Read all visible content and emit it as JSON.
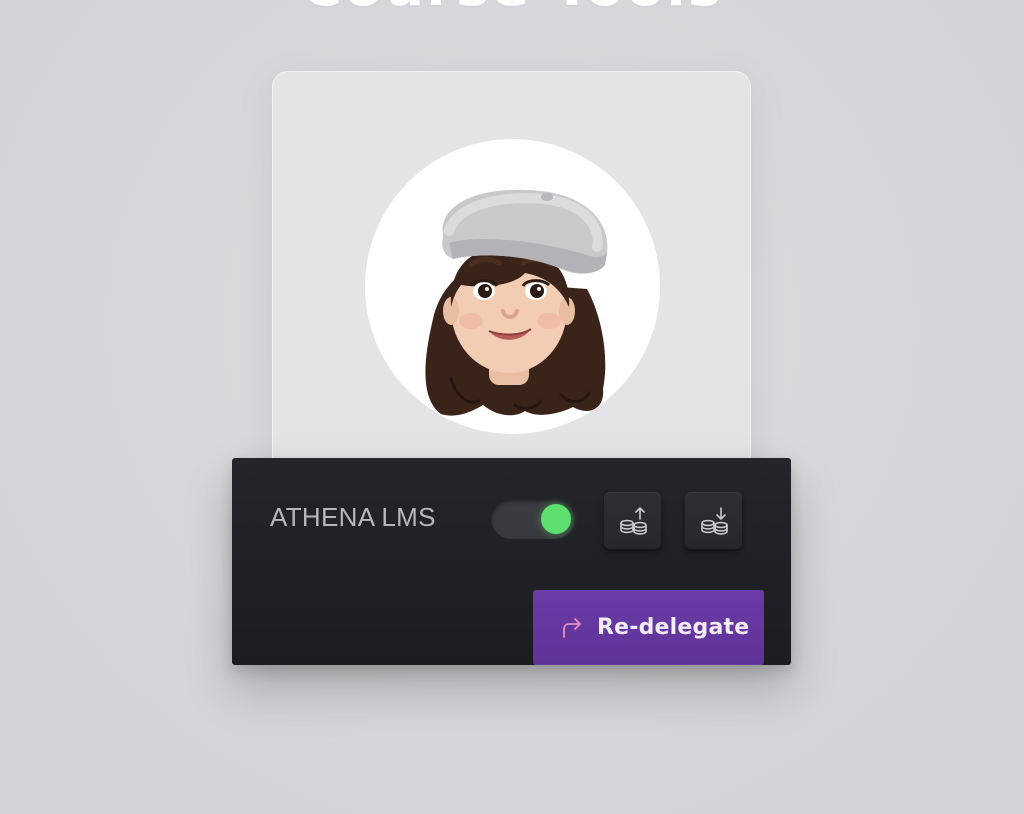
{
  "page": {
    "title": "Course Tools"
  },
  "card": {
    "avatar_alt": "memoji-avatar"
  },
  "panel": {
    "org_name": "ATHENA LMS",
    "toggle_on": true,
    "actions": [
      {
        "name": "deposit",
        "icon": "coins-arrow-up-icon"
      },
      {
        "name": "withdraw",
        "icon": "coins-arrow-down-icon"
      }
    ],
    "primary_action": {
      "label": "Re-delegate",
      "icon": "redirect-arrow-icon"
    }
  },
  "colors": {
    "accent": "#5e3396",
    "toggle_on": "#5de06f",
    "panel_bg": "#1f2024",
    "card_bg": "#e4e4e7"
  }
}
